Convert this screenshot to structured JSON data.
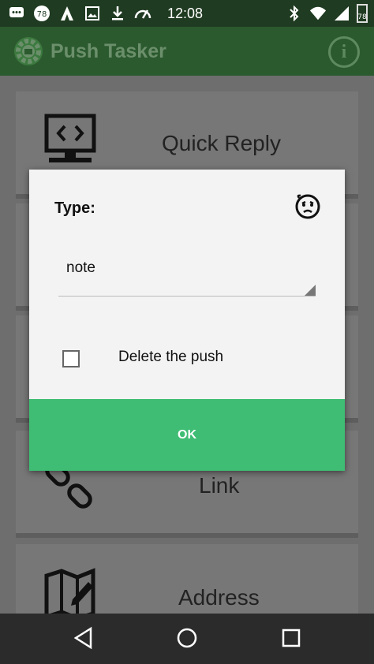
{
  "status_bar": {
    "time": "12:08",
    "notification_badge": "78",
    "battery_level": "78",
    "icons": [
      "chat-icon",
      "badge-icon",
      "app-icon",
      "image-icon",
      "download-icon",
      "speed-icon",
      "bluetooth-icon",
      "wifi-icon",
      "signal-icon",
      "battery-icon"
    ]
  },
  "app_bar": {
    "title": "Push Tasker",
    "info_label": "i"
  },
  "cards": [
    {
      "label": "Quick Reply",
      "icon": "code-monitor-icon"
    },
    {
      "label": "Link",
      "icon": "link-icon"
    },
    {
      "label": "Address",
      "icon": "map-edit-icon"
    }
  ],
  "dialog": {
    "title": "Type:",
    "icon": "emoji-icon",
    "spinner_value": "note",
    "checkbox_label": "Delete the push",
    "checkbox_checked": false,
    "ok_label": "OK"
  },
  "nav_bar": {
    "icons": [
      "back-icon",
      "home-icon",
      "recents-icon"
    ]
  },
  "colors": {
    "status_bar": "#1f3b21",
    "app_bar": "#2c5a2f",
    "ok_button": "#3fbd74"
  }
}
